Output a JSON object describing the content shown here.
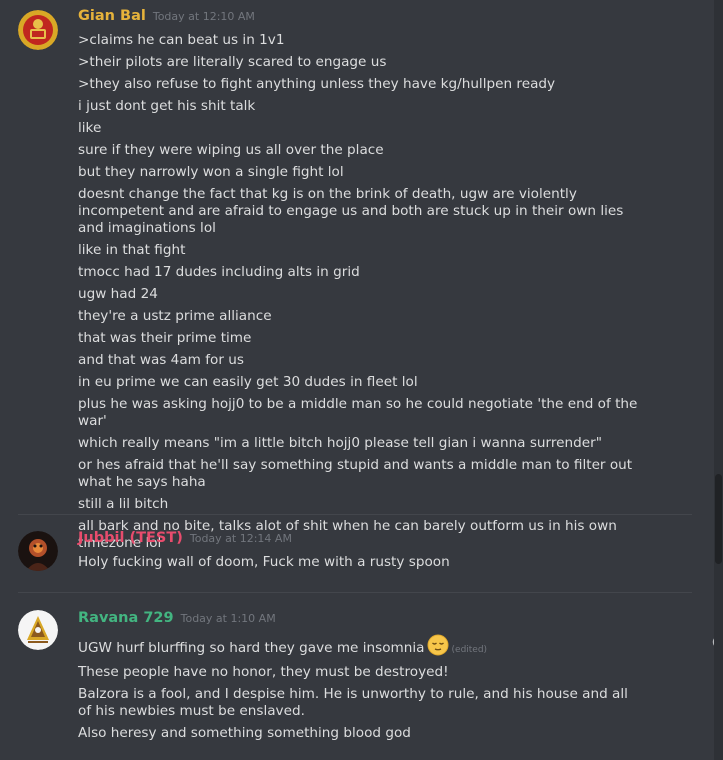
{
  "colors": {
    "background": "#36393f",
    "text": "#dcddde",
    "timestamp": "#72767d",
    "user1": "#e6b33b",
    "user2": "#e84c6d",
    "user3": "#43b581"
  },
  "messages": [
    {
      "username": "Gian Bal",
      "timestamp": "Today at 12:10 AM",
      "lines": [
        ">claims he can beat us in 1v1",
        ">their pilots are literally  scared to engage us",
        ">they also refuse to fight anything unless they have kg/hullpen ready",
        "i just dont get his shit talk",
        "like",
        "sure if they were wiping us all over the place",
        "but they narrowly won a single fight lol",
        "doesnt change the fact that kg is on the brink of death, ugw are violently incompetent and are afraid to engage us and both are stuck up in their own lies and imaginations lol",
        "like in that fight",
        "tmocc had 17 dudes including alts in grid",
        "ugw had 24",
        "they're a ustz prime alliance",
        "that was their prime time",
        "and that was 4am for us",
        "in eu prime we can easily get 30 dudes in fleet lol",
        "plus he was asking hojj0 to be a middle man so he could negotiate 'the end of the war'",
        "which really means \"im a little bitch hojj0 please tell gian i wanna surrender\"",
        "or hes afraid that he'll say something stupid and wants a middle man to filter out what he says haha",
        "still a lil bitch",
        "all bark and no bite, talks alot of shit when he can barely outform us in his own timezone lol"
      ]
    },
    {
      "username": "Jubbil (TEST)",
      "timestamp": "Today at 12:14 AM",
      "lines": [
        "Holy fucking wall of doom, Fuck me with a rusty spoon"
      ]
    },
    {
      "username": "Ravana 729",
      "timestamp": "Today at 1:10 AM",
      "first_line": "UGW hurf blurffing so hard they gave me insomnia",
      "edited": "(edited)",
      "emoji": "relieved-face-icon",
      "lines": [
        "These people have no honor, they must be destroyed!",
        "Balzora is a fool, and I despise him. He is unworthy to rule, and his house and all of his newbies must be enslaved.",
        "Also heresy and something something blood god"
      ]
    }
  ]
}
